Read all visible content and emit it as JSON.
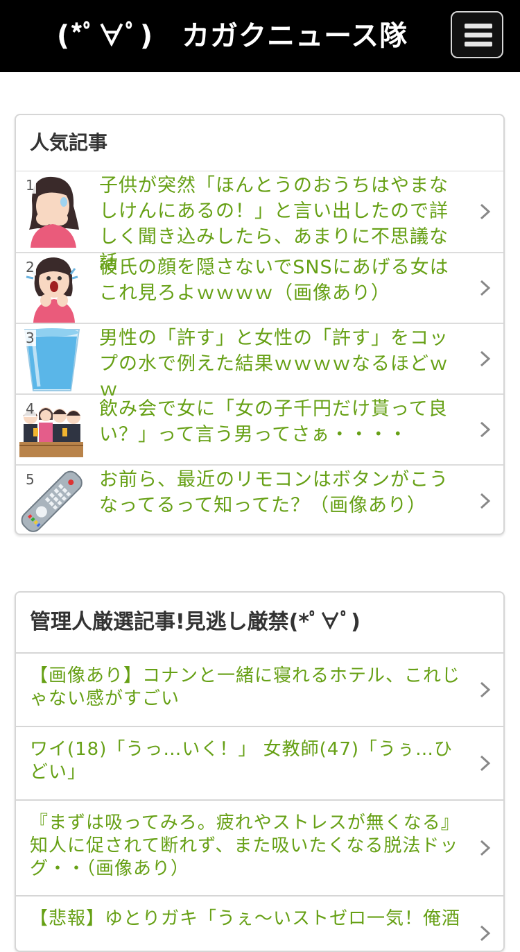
{
  "header": {
    "site_title": "(*ﾟ∀ﾟ)　カガクニュース隊",
    "menu_icon": "hamburger-menu-icon"
  },
  "popular": {
    "title": "人気記事",
    "items": [
      {
        "rank": "1",
        "title": "子供が突然「ほんとうのおうちはやまなしけんにあるの！」と言い出したので詳しく聞き込みしたら、あまりに不思議な話",
        "icon": "surprised-woman-icon"
      },
      {
        "rank": "2",
        "title": "彼氏の顔を隠さないでSNSにあげる女はこれ見ろよｗｗｗｗ（画像あり）",
        "icon": "shocked-woman-icon"
      },
      {
        "rank": "3",
        "title": "男性の「許す」と女性の「許す」をコップの水で例えた結果ｗｗｗｗなるほどｗｗ",
        "icon": "glass-of-water-icon"
      },
      {
        "rank": "4",
        "title": "飲み会で女に「女の子千円だけ貰って良い？」って言う男ってさぁ・・・・",
        "icon": "drinking-party-icon"
      },
      {
        "rank": "5",
        "title": "お前ら、最近のリモコンはボタンがこうなってるって知ってた？（画像あり）",
        "icon": "remote-control-icon"
      }
    ]
  },
  "picks": {
    "title": "管理人厳選記事!見逃し厳禁(*ﾟ∀ﾟ)",
    "items": [
      {
        "title": "【画像あり】コナンと一緒に寝れるホテル、これじゃない感がすごい"
      },
      {
        "title": "ワイ(18)「うっ…いく！」 女教師(47)「うぅ…ひどい」"
      },
      {
        "title": "『まずは吸ってみろ。疲れやストレスが無くなる』知人に促されて断れず、また吸いたくなる脱法ドッグ・・（画像あり）"
      },
      {
        "title": "【悲報】ゆとりガキ「うぇ～いストゼロ一気！俺酒"
      }
    ]
  },
  "colors": {
    "link": "#66a015",
    "header_bg": "#000000"
  }
}
